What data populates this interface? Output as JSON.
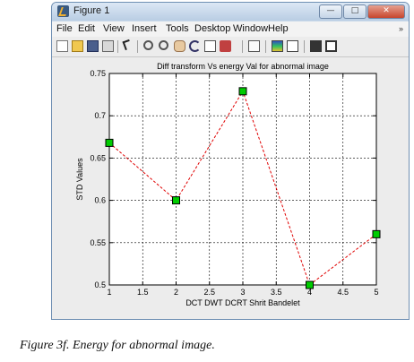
{
  "window": {
    "title": "Figure 1",
    "buttons": {
      "minimize": "—",
      "maximize": "□",
      "close": "✕"
    },
    "menu": [
      "File",
      "Edit",
      "View",
      "Insert",
      "Tools",
      "Desktop",
      "Window",
      "Help"
    ],
    "menu_arrow": "»",
    "toolbar_icons": [
      "new-figure-icon",
      "open-file-icon",
      "save-icon",
      "print-icon",
      "edit-plot-arrow-icon",
      "zoom-in-icon",
      "zoom-out-icon",
      "pan-icon",
      "rotate-3d-icon",
      "data-cursor-icon",
      "brush-icon",
      "link-plot-icon",
      "colorbar-icon",
      "legend-icon",
      "hide-plot-tools-icon",
      "show-plot-tools-icon"
    ]
  },
  "chart_data": {
    "type": "line",
    "title": "Diff transform Vs energy Val for abnormal image",
    "xlabel": "DCT DWT DCRT Shrit Bandelet",
    "ylabel": "STD Values",
    "xlim": [
      1,
      5
    ],
    "ylim": [
      0.5,
      0.75
    ],
    "xticks": [
      "1",
      "1.5",
      "2",
      "2.5",
      "3",
      "3.5",
      "4",
      "4.5",
      "5"
    ],
    "yticks": [
      "0.5",
      "0.55",
      "0.6",
      "0.65",
      "0.7",
      "0.75"
    ],
    "grid": true,
    "series": [
      {
        "x": [
          1,
          2,
          3,
          4,
          5
        ],
        "y": [
          0.668,
          0.6,
          0.729,
          0.5,
          0.56
        ],
        "line_color": "#e00000",
        "line_style": "dashed",
        "marker": "square",
        "marker_color": "#00cc00"
      }
    ]
  },
  "caption": {
    "label": "Figure 3f.",
    "text": "Energy for abnormal image."
  }
}
